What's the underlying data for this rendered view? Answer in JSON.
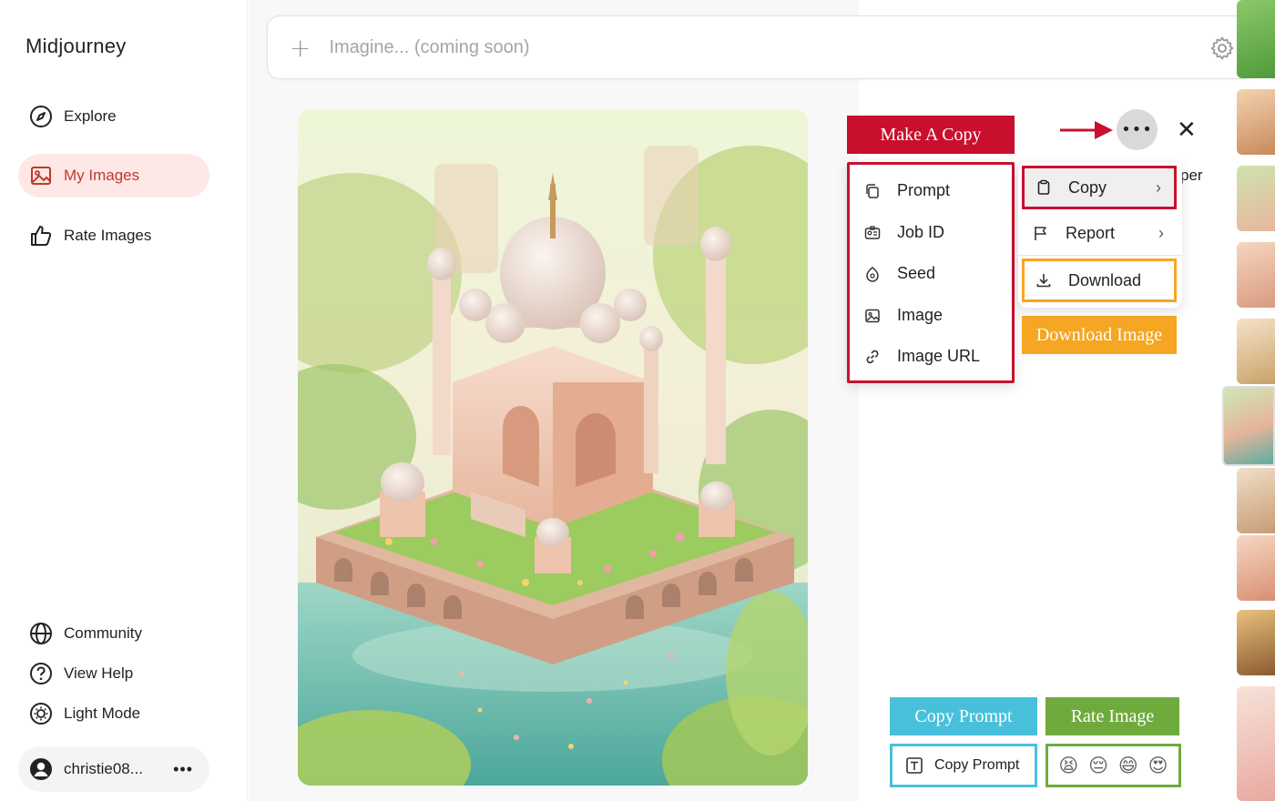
{
  "sidebar": {
    "logo": "Midjourney",
    "nav": [
      {
        "label": "Explore",
        "icon": "compass-icon"
      },
      {
        "label": "My Images",
        "icon": "image-icon",
        "active": true
      },
      {
        "label": "Rate Images",
        "icon": "thumbs-up-icon"
      }
    ],
    "bottom": [
      {
        "label": "Community",
        "icon": "globe-icon"
      },
      {
        "label": "View Help",
        "icon": "help-icon"
      },
      {
        "label": "Light Mode",
        "icon": "sun-icon"
      }
    ],
    "user": {
      "name": "christie08...",
      "more": "•••"
    }
  },
  "search": {
    "plus": "+",
    "placeholder": "Imagine... (coming soon)"
  },
  "toolbar": {
    "more": "•••",
    "close": "✕"
  },
  "menus": {
    "main": [
      {
        "label": "Copy",
        "icon": "clipboard-icon",
        "chevron": "›"
      },
      {
        "label": "Report",
        "icon": "flag-icon",
        "chevron": "›"
      },
      {
        "label": "Download",
        "icon": "download-icon"
      }
    ],
    "copy_submenu": [
      {
        "label": "Prompt",
        "icon": "copy-icon"
      },
      {
        "label": "Job ID",
        "icon": "id-card-icon"
      },
      {
        "label": "Seed",
        "icon": "seed-icon"
      },
      {
        "label": "Image",
        "icon": "image-icon"
      },
      {
        "label": "Image URL",
        "icon": "link-icon"
      }
    ]
  },
  "annotations": {
    "make_copy": "Make A Copy",
    "download_image": "Download Image",
    "copy_prompt": "Copy Prompt",
    "rate_image": "Rate Image"
  },
  "bottom_actions": {
    "copy_prompt_label": "Copy Prompt",
    "rating_emojis": [
      "😫",
      "😔",
      "😄",
      "😍"
    ]
  },
  "partial_text": "per",
  "colors": {
    "red": "#c8102e",
    "orange": "#f5a623",
    "blue": "#48c0dc",
    "green": "#6fab3c",
    "active_bg": "#fde8e6"
  }
}
